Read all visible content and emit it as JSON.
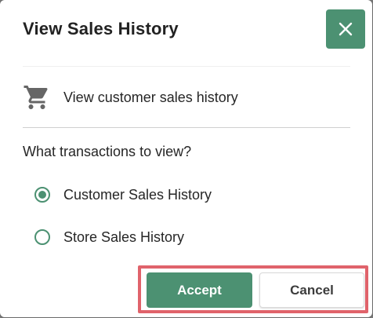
{
  "dialog": {
    "title": "View Sales History",
    "close_icon": "close-icon",
    "info_icon": "shopping-cart-icon",
    "info_text": "View customer sales history",
    "question": "What transactions to view?",
    "options": [
      {
        "label": "Customer Sales History",
        "selected": true
      },
      {
        "label": "Store Sales History",
        "selected": false
      }
    ],
    "accept_label": "Accept",
    "cancel_label": "Cancel"
  },
  "colors": {
    "accent": "#4c9172",
    "highlight": "#e0636b"
  }
}
